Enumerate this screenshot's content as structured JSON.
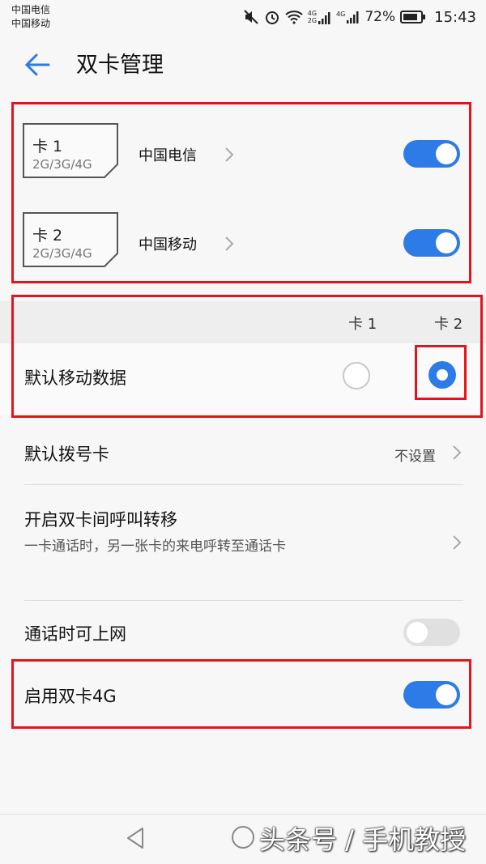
{
  "status_bar": {
    "carrier1": "中国电信",
    "carrier2": "中国移动",
    "net_label_top": "4G",
    "net_label_bottom": "2G",
    "net_label2": "4G",
    "battery": "72%",
    "time": "15:43"
  },
  "header": {
    "title": "双卡管理"
  },
  "sims": [
    {
      "name": "卡 1",
      "network": "2G/3G/4G",
      "carrier": "中国电信",
      "enabled": true
    },
    {
      "name": "卡 2",
      "network": "2G/3G/4G",
      "carrier": "中国移动",
      "enabled": true
    }
  ],
  "default_data": {
    "columns": [
      "卡 1",
      "卡 2"
    ],
    "label": "默认移动数据",
    "selected_index": 1
  },
  "settings": {
    "default_dial": {
      "label": "默认拨号卡",
      "value": "不设置"
    },
    "call_forward": {
      "label": "开启双卡间呼叫转移",
      "description": "一卡通话时，另一张卡的来电呼转至通话卡"
    },
    "data_during_call": {
      "label": "通话时可上网",
      "enabled": false
    },
    "dual_4g": {
      "label": "启用双卡4G",
      "enabled": true
    }
  },
  "watermark": "头条号 / 手机教授",
  "colors": {
    "accent": "#2d7be6",
    "highlight": "#e4141b"
  }
}
